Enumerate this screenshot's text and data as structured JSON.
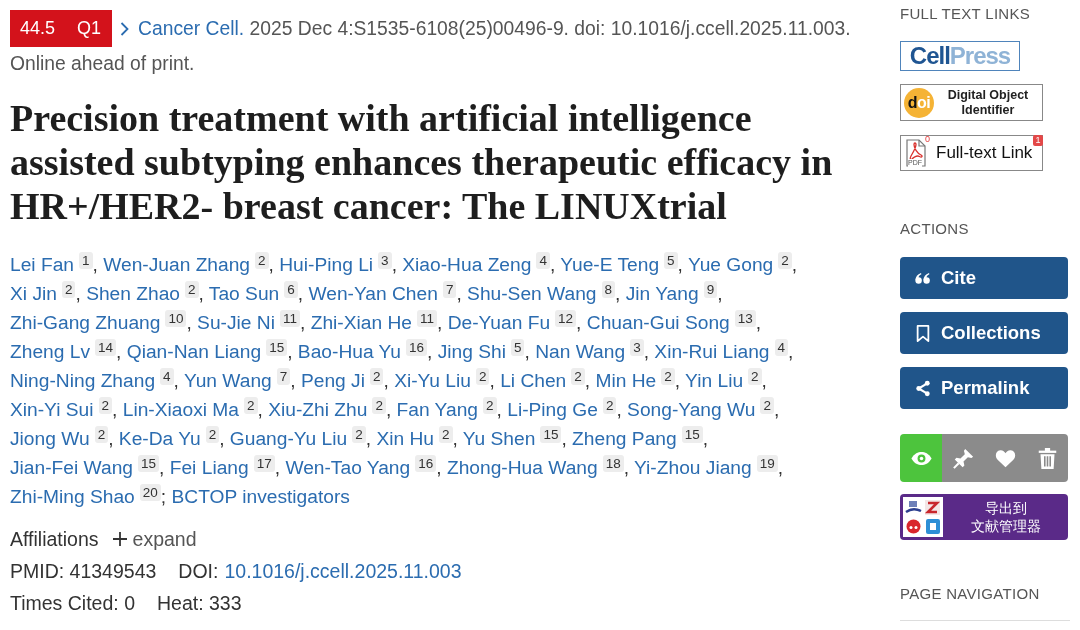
{
  "article": {
    "badge": {
      "impact_factor": "44.5",
      "quartile": "Q1"
    },
    "citation": {
      "journal": "Cancer Cell.",
      "details": "2025 Dec 4:S1535-6108(25)00496-9. doi: 10.1016/j.ccell.2025.11.003.",
      "status": "Online ahead of print."
    },
    "title": "Precision treatment with artificial intelligence assisted subtyping enhances therapeutic efficacy in HR+/HER2- breast cancer: The LINUXtrial",
    "authors": [
      {
        "name": "Lei Fan",
        "affiliation": "1",
        "separator": ","
      },
      {
        "name": "Wen-Juan Zhang",
        "affiliation": "2",
        "separator": ","
      },
      {
        "name": "Hui-Ping Li",
        "affiliation": "3",
        "separator": ","
      },
      {
        "name": "Xiao-Hua Zeng",
        "affiliation": "4",
        "separator": ","
      },
      {
        "name": "Yue-E Teng",
        "affiliation": "5",
        "separator": ","
      },
      {
        "name": "Yue Gong",
        "affiliation": "2",
        "separator": ","
      },
      {
        "name": "Xi Jin",
        "affiliation": "2",
        "separator": ","
      },
      {
        "name": "Shen Zhao",
        "affiliation": "2",
        "separator": ","
      },
      {
        "name": "Tao Sun",
        "affiliation": "6",
        "separator": ","
      },
      {
        "name": "Wen-Yan Chen",
        "affiliation": "7",
        "separator": ","
      },
      {
        "name": "Shu-Sen Wang",
        "affiliation": "8",
        "separator": ","
      },
      {
        "name": "Jin Yang",
        "affiliation": "9",
        "separator": ","
      },
      {
        "name": "Zhi-Gang Zhuang",
        "affiliation": "10",
        "separator": ","
      },
      {
        "name": "Su-Jie Ni",
        "affiliation": "11",
        "separator": ","
      },
      {
        "name": "Zhi-Xian He",
        "affiliation": "11",
        "separator": ","
      },
      {
        "name": "De-Yuan Fu",
        "affiliation": "12",
        "separator": ","
      },
      {
        "name": "Chuan-Gui Song",
        "affiliation": "13",
        "separator": ","
      },
      {
        "name": "Zheng Lv",
        "affiliation": "14",
        "separator": ","
      },
      {
        "name": "Qian-Nan Liang",
        "affiliation": "15",
        "separator": ","
      },
      {
        "name": "Bao-Hua Yu",
        "affiliation": "16",
        "separator": ","
      },
      {
        "name": "Jing Shi",
        "affiliation": "5",
        "separator": ","
      },
      {
        "name": "Nan Wang",
        "affiliation": "3",
        "separator": ","
      },
      {
        "name": "Xin-Rui Liang",
        "affiliation": "4",
        "separator": ","
      },
      {
        "name": "Ning-Ning Zhang",
        "affiliation": "4",
        "separator": ","
      },
      {
        "name": "Yun Wang",
        "affiliation": "7",
        "separator": ","
      },
      {
        "name": "Peng Ji",
        "affiliation": "2",
        "separator": ","
      },
      {
        "name": "Xi-Yu Liu",
        "affiliation": "2",
        "separator": ","
      },
      {
        "name": "Li Chen",
        "affiliation": "2",
        "separator": ","
      },
      {
        "name": "Min He",
        "affiliation": "2",
        "separator": ","
      },
      {
        "name": "Yin Liu",
        "affiliation": "2",
        "separator": ","
      },
      {
        "name": "Xin-Yi Sui",
        "affiliation": "2",
        "separator": ","
      },
      {
        "name": "Lin-Xiaoxi Ma",
        "affiliation": "2",
        "separator": ","
      },
      {
        "name": "Xiu-Zhi Zhu",
        "affiliation": "2",
        "separator": ","
      },
      {
        "name": "Fan Yang",
        "affiliation": "2",
        "separator": ","
      },
      {
        "name": "Li-Ping Ge",
        "affiliation": "2",
        "separator": ","
      },
      {
        "name": "Song-Yang Wu",
        "affiliation": "2",
        "separator": ","
      },
      {
        "name": "Jiong Wu",
        "affiliation": "2",
        "separator": ","
      },
      {
        "name": "Ke-Da Yu",
        "affiliation": "2",
        "separator": ","
      },
      {
        "name": "Guang-Yu Liu",
        "affiliation": "2",
        "separator": ","
      },
      {
        "name": "Xin Hu",
        "affiliation": "2",
        "separator": ","
      },
      {
        "name": "Yu Shen",
        "affiliation": "15",
        "separator": ","
      },
      {
        "name": "Zheng Pang",
        "affiliation": "15",
        "separator": ","
      },
      {
        "name": "Jian-Fei Wang",
        "affiliation": "15",
        "separator": ","
      },
      {
        "name": "Fei Liang",
        "affiliation": "17",
        "separator": ","
      },
      {
        "name": "Wen-Tao Yang",
        "affiliation": "16",
        "separator": ","
      },
      {
        "name": "Zhong-Hua Wang",
        "affiliation": "18",
        "separator": ","
      },
      {
        "name": "Yi-Zhou Jiang",
        "affiliation": "19",
        "separator": ","
      },
      {
        "name": "Zhi-Ming Shao",
        "affiliation": "20",
        "separator": ";"
      }
    ],
    "group_author": "BCTOP investigators",
    "affiliations": {
      "label": "Affiliations",
      "action": "expand"
    },
    "identifiers": {
      "pmid": "PMID: 41349543",
      "doi_label": "DOI:",
      "doi": "10.1016/j.ccell.2025.11.003"
    },
    "stats": {
      "times_cited": "Times Cited: 0",
      "heat": "Heat: 333"
    }
  },
  "sidebar": {
    "full_text_links": {
      "heading": "FULL TEXT LINKS",
      "items": [
        {
          "kind": "cellpress",
          "text_parts": [
            "Cell",
            "Press"
          ]
        },
        {
          "kind": "doi",
          "mark_parts": [
            "d",
            "oi"
          ],
          "text": "Digital Object Identifier"
        },
        {
          "kind": "fulltext",
          "icon_label": "PDF",
          "icon_count": "0",
          "text": "Full-text Link",
          "badge": "1"
        }
      ]
    },
    "actions": {
      "heading": "ACTIONS",
      "buttons": [
        {
          "kind": "cite",
          "label": "Cite"
        },
        {
          "kind": "collections",
          "label": "Collections"
        },
        {
          "kind": "permalink",
          "label": "Permalink"
        }
      ]
    },
    "tools": [
      {
        "kind": "eye",
        "on": true
      },
      {
        "kind": "pin",
        "on": false
      },
      {
        "kind": "heart",
        "on": false
      },
      {
        "kind": "trash",
        "on": false
      }
    ],
    "export": {
      "label_lines": [
        "导出到",
        "文献管理器"
      ]
    },
    "page_navigation": {
      "heading": "PAGE NAVIGATION"
    }
  }
}
